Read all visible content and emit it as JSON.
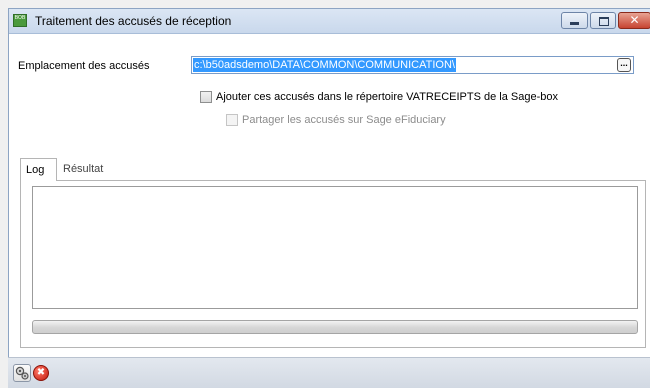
{
  "window": {
    "title": "Traitement des accusés de réception",
    "app_icon_text": "BOB",
    "close_glyph": "✕"
  },
  "form": {
    "location_label": "Emplacement des accusés",
    "location_value": "c:\\b50adsdemo\\DATA\\COMMON\\COMMUNICATION\\",
    "browse_glyph": "...",
    "add_receipts_label": "Ajouter ces accusés dans le répertoire VATRECEIPTS de la Sage-box",
    "add_receipts_checked": false,
    "share_label": "Partager les accusés sur Sage eFiduciary",
    "share_checked": false,
    "share_enabled": false
  },
  "tabs": [
    {
      "label": "Log",
      "active": true
    },
    {
      "label": "Résultat",
      "active": false
    }
  ],
  "log": {
    "text": ""
  },
  "progress": {
    "fraction": 0
  },
  "toolbar": {
    "run_icon": "gears-icon",
    "cancel_icon": "cancel-icon",
    "cancel_glyph": "✖"
  },
  "colors": {
    "selection": "#3399ff",
    "titlebar": "#c9d8ec",
    "close_button": "#c74431"
  }
}
